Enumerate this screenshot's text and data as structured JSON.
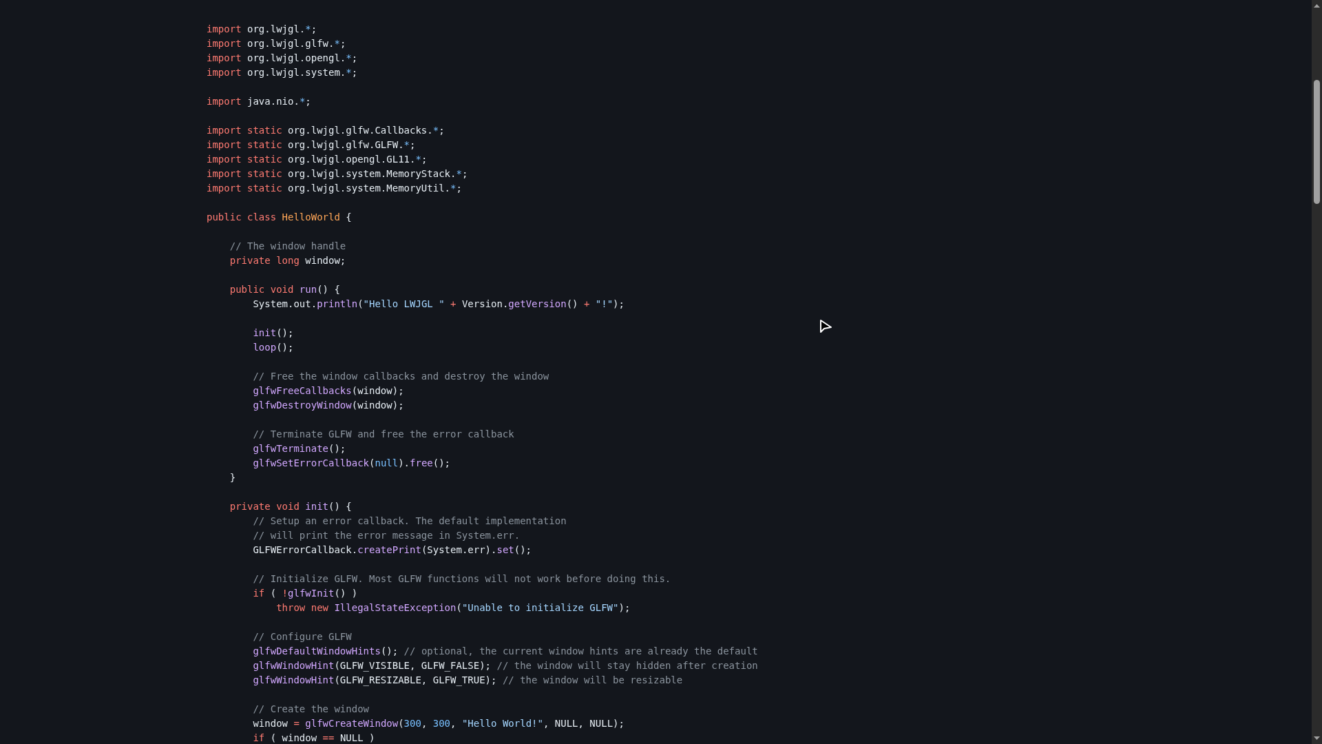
{
  "code_lines": [
    {
      "kind": "code",
      "tokens": [
        {
          "kind": "kw",
          "text": "import"
        },
        {
          "kind": "pl",
          "text": " org.lwjgl."
        },
        {
          "kind": "num",
          "text": "*"
        },
        {
          "kind": "pl",
          "text": ";"
        }
      ]
    },
    {
      "kind": "code",
      "tokens": [
        {
          "kind": "kw",
          "text": "import"
        },
        {
          "kind": "pl",
          "text": " org.lwjgl.glfw."
        },
        {
          "kind": "num",
          "text": "*"
        },
        {
          "kind": "pl",
          "text": ";"
        }
      ]
    },
    {
      "kind": "code",
      "tokens": [
        {
          "kind": "kw",
          "text": "import"
        },
        {
          "kind": "pl",
          "text": " org.lwjgl.opengl."
        },
        {
          "kind": "num",
          "text": "*"
        },
        {
          "kind": "pl",
          "text": ";"
        }
      ]
    },
    {
      "kind": "code",
      "tokens": [
        {
          "kind": "kw",
          "text": "import"
        },
        {
          "kind": "pl",
          "text": " org.lwjgl.system."
        },
        {
          "kind": "num",
          "text": "*"
        },
        {
          "kind": "pl",
          "text": ";"
        }
      ]
    },
    {
      "kind": "blank"
    },
    {
      "kind": "code",
      "tokens": [
        {
          "kind": "kw",
          "text": "import"
        },
        {
          "kind": "pl",
          "text": " java.nio."
        },
        {
          "kind": "num",
          "text": "*"
        },
        {
          "kind": "pl",
          "text": ";"
        }
      ]
    },
    {
      "kind": "blank"
    },
    {
      "kind": "code",
      "tokens": [
        {
          "kind": "kw",
          "text": "import static"
        },
        {
          "kind": "pl",
          "text": " org.lwjgl.glfw.Callbacks."
        },
        {
          "kind": "num",
          "text": "*"
        },
        {
          "kind": "pl",
          "text": ";"
        }
      ]
    },
    {
      "kind": "code",
      "tokens": [
        {
          "kind": "kw",
          "text": "import static"
        },
        {
          "kind": "pl",
          "text": " org.lwjgl.glfw.GLFW."
        },
        {
          "kind": "num",
          "text": "*"
        },
        {
          "kind": "pl",
          "text": ";"
        }
      ]
    },
    {
      "kind": "code",
      "tokens": [
        {
          "kind": "kw",
          "text": "import static"
        },
        {
          "kind": "pl",
          "text": " org.lwjgl.opengl.GL11."
        },
        {
          "kind": "num",
          "text": "*"
        },
        {
          "kind": "pl",
          "text": ";"
        }
      ]
    },
    {
      "kind": "code",
      "tokens": [
        {
          "kind": "kw",
          "text": "import static"
        },
        {
          "kind": "pl",
          "text": " org.lwjgl.system.MemoryStack."
        },
        {
          "kind": "num",
          "text": "*"
        },
        {
          "kind": "pl",
          "text": ";"
        }
      ]
    },
    {
      "kind": "code",
      "tokens": [
        {
          "kind": "kw",
          "text": "import static"
        },
        {
          "kind": "pl",
          "text": " org.lwjgl.system.MemoryUtil."
        },
        {
          "kind": "num",
          "text": "*"
        },
        {
          "kind": "pl",
          "text": ";"
        }
      ]
    },
    {
      "kind": "blank"
    },
    {
      "kind": "code",
      "tokens": [
        {
          "kind": "kw",
          "text": "public class"
        },
        {
          "kind": "cls",
          "text": " HelloWorld"
        },
        {
          "kind": "pl",
          "text": " {"
        }
      ]
    },
    {
      "kind": "blank"
    },
    {
      "kind": "code",
      "tokens": [
        {
          "kind": "cm",
          "text": "    // The window handle"
        }
      ]
    },
    {
      "kind": "code",
      "tokens": [
        {
          "kind": "kw",
          "text": "    private long"
        },
        {
          "kind": "pl",
          "text": " window;"
        }
      ]
    },
    {
      "kind": "blank"
    },
    {
      "kind": "code",
      "tokens": [
        {
          "kind": "kw",
          "text": "    public void"
        },
        {
          "kind": "fn",
          "text": " run"
        },
        {
          "kind": "pl",
          "text": "() {"
        }
      ]
    },
    {
      "kind": "code",
      "tokens": [
        {
          "kind": "pl",
          "text": "        System.out."
        },
        {
          "kind": "fn",
          "text": "println"
        },
        {
          "kind": "pl",
          "text": "("
        },
        {
          "kind": "str",
          "text": "\"Hello LWJGL \""
        },
        {
          "kind": "op",
          "text": " +"
        },
        {
          "kind": "pl",
          "text": " Version."
        },
        {
          "kind": "fn",
          "text": "getVersion"
        },
        {
          "kind": "pl",
          "text": "() "
        },
        {
          "kind": "op",
          "text": "+"
        },
        {
          "kind": "str",
          "text": " \"!\""
        },
        {
          "kind": "pl",
          "text": ");"
        }
      ]
    },
    {
      "kind": "blank"
    },
    {
      "kind": "code",
      "tokens": [
        {
          "kind": "fn",
          "text": "        init"
        },
        {
          "kind": "pl",
          "text": "();"
        }
      ]
    },
    {
      "kind": "code",
      "tokens": [
        {
          "kind": "fn",
          "text": "        loop"
        },
        {
          "kind": "pl",
          "text": "();"
        }
      ]
    },
    {
      "kind": "blank"
    },
    {
      "kind": "code",
      "tokens": [
        {
          "kind": "cm",
          "text": "        // Free the window callbacks and destroy the window"
        }
      ]
    },
    {
      "kind": "code",
      "tokens": [
        {
          "kind": "fn",
          "text": "        glfwFreeCallbacks"
        },
        {
          "kind": "pl",
          "text": "(window);"
        }
      ]
    },
    {
      "kind": "code",
      "tokens": [
        {
          "kind": "fn",
          "text": "        glfwDestroyWindow"
        },
        {
          "kind": "pl",
          "text": "(window);"
        }
      ]
    },
    {
      "kind": "blank"
    },
    {
      "kind": "code",
      "tokens": [
        {
          "kind": "cm",
          "text": "        // Terminate GLFW and free the error callback"
        }
      ]
    },
    {
      "kind": "code",
      "tokens": [
        {
          "kind": "fn",
          "text": "        glfwTerminate"
        },
        {
          "kind": "pl",
          "text": "();"
        }
      ]
    },
    {
      "kind": "code",
      "tokens": [
        {
          "kind": "fn",
          "text": "        glfwSetErrorCallback"
        },
        {
          "kind": "pl",
          "text": "("
        },
        {
          "kind": "num",
          "text": "null"
        },
        {
          "kind": "pl",
          "text": ")."
        },
        {
          "kind": "fn",
          "text": "free"
        },
        {
          "kind": "pl",
          "text": "();"
        }
      ]
    },
    {
      "kind": "code",
      "tokens": [
        {
          "kind": "pl",
          "text": "    }"
        }
      ]
    },
    {
      "kind": "blank"
    },
    {
      "kind": "code",
      "tokens": [
        {
          "kind": "kw",
          "text": "    private void"
        },
        {
          "kind": "fn",
          "text": " init"
        },
        {
          "kind": "pl",
          "text": "() {"
        }
      ]
    },
    {
      "kind": "code",
      "tokens": [
        {
          "kind": "cm",
          "text": "        // Setup an error callback. The default implementation"
        }
      ]
    },
    {
      "kind": "code",
      "tokens": [
        {
          "kind": "cm",
          "text": "        // will print the error message in System.err."
        }
      ]
    },
    {
      "kind": "code",
      "tokens": [
        {
          "kind": "pl",
          "text": "        GLFWErrorCallback."
        },
        {
          "kind": "fn",
          "text": "createPrint"
        },
        {
          "kind": "pl",
          "text": "(System.err)."
        },
        {
          "kind": "fn",
          "text": "set"
        },
        {
          "kind": "pl",
          "text": "();"
        }
      ]
    },
    {
      "kind": "blank"
    },
    {
      "kind": "code",
      "tokens": [
        {
          "kind": "cm",
          "text": "        // Initialize GLFW. Most GLFW functions will not work before doing this."
        }
      ]
    },
    {
      "kind": "code",
      "tokens": [
        {
          "kind": "kw",
          "text": "        if"
        },
        {
          "kind": "pl",
          "text": " ( "
        },
        {
          "kind": "op",
          "text": "!"
        },
        {
          "kind": "fn",
          "text": "glfwInit"
        },
        {
          "kind": "pl",
          "text": "() )"
        }
      ]
    },
    {
      "kind": "code",
      "tokens": [
        {
          "kind": "kw",
          "text": "            throw new"
        },
        {
          "kind": "fn",
          "text": " IllegalStateException"
        },
        {
          "kind": "pl",
          "text": "("
        },
        {
          "kind": "str",
          "text": "\"Unable to initialize GLFW\""
        },
        {
          "kind": "pl",
          "text": ");"
        }
      ]
    },
    {
      "kind": "blank"
    },
    {
      "kind": "code",
      "tokens": [
        {
          "kind": "cm",
          "text": "        // Configure GLFW"
        }
      ]
    },
    {
      "kind": "code",
      "tokens": [
        {
          "kind": "fn",
          "text": "        glfwDefaultWindowHints"
        },
        {
          "kind": "pl",
          "text": "(); "
        },
        {
          "kind": "cm",
          "text": "// optional, the current window hints are already the default"
        }
      ]
    },
    {
      "kind": "code",
      "tokens": [
        {
          "kind": "fn",
          "text": "        glfwWindowHint"
        },
        {
          "kind": "pl",
          "text": "(GLFW_VISIBLE, GLFW_FALSE); "
        },
        {
          "kind": "cm",
          "text": "// the window will stay hidden after creation"
        }
      ]
    },
    {
      "kind": "code",
      "tokens": [
        {
          "kind": "fn",
          "text": "        glfwWindowHint"
        },
        {
          "kind": "pl",
          "text": "(GLFW_RESIZABLE, GLFW_TRUE); "
        },
        {
          "kind": "cm",
          "text": "// the window will be resizable"
        }
      ]
    },
    {
      "kind": "blank"
    },
    {
      "kind": "code",
      "tokens": [
        {
          "kind": "cm",
          "text": "        // Create the window"
        }
      ]
    },
    {
      "kind": "code",
      "tokens": [
        {
          "kind": "pl",
          "text": "        window "
        },
        {
          "kind": "op",
          "text": "="
        },
        {
          "kind": "fn",
          "text": " glfwCreateWindow"
        },
        {
          "kind": "pl",
          "text": "("
        },
        {
          "kind": "num",
          "text": "300"
        },
        {
          "kind": "pl",
          "text": ", "
        },
        {
          "kind": "num",
          "text": "300"
        },
        {
          "kind": "pl",
          "text": ", "
        },
        {
          "kind": "str",
          "text": "\"Hello World!\""
        },
        {
          "kind": "pl",
          "text": ", NULL, NULL);"
        }
      ]
    },
    {
      "kind": "code",
      "tokens": [
        {
          "kind": "kw",
          "text": "        if"
        },
        {
          "kind": "pl",
          "text": " ( window "
        },
        {
          "kind": "op",
          "text": "=="
        },
        {
          "kind": "pl",
          "text": " NULL )"
        }
      ]
    }
  ]
}
